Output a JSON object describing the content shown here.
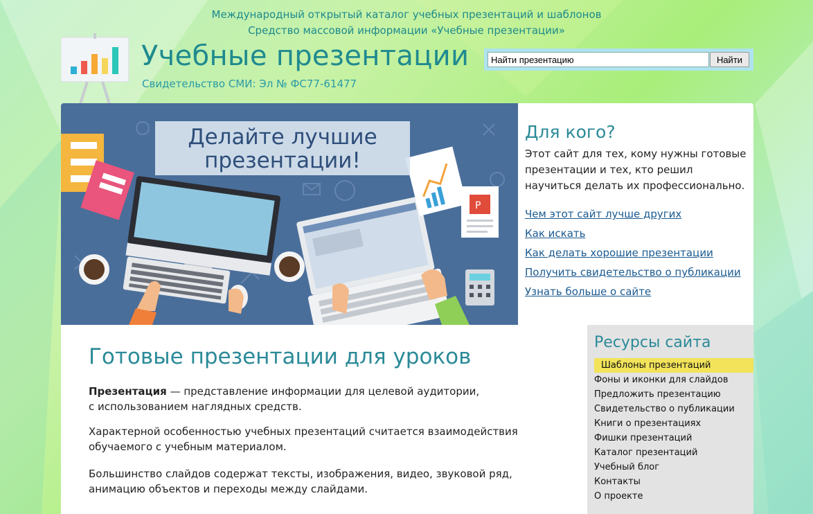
{
  "header": {
    "tagline1": "Международный открытый каталог учебных презентаций и шаблонов",
    "tagline2": "Средство массовой информации «Учебные презентации»",
    "site_title": "Учебные презентации",
    "certificate": "Свидетельство СМИ: Эл № ФС77-61477"
  },
  "search": {
    "value": "Найти презентацию",
    "button_label": "Найти"
  },
  "hero": {
    "banner_line1": "Делайте лучшие",
    "banner_line2": "презентации!"
  },
  "who": {
    "title": "Для кого?",
    "text": "Этот сайт для тех, кому нужны готовые презентации и тех, кто решил научиться делать их профессионально.",
    "links": [
      "Чем этот сайт лучше других",
      "Как искать",
      "Как делать хорошие презентации",
      "Получить свидетельство о публикации",
      "Узнать больше о сайте"
    ]
  },
  "main": {
    "title": "Готовые презентации для уроков",
    "p1_bold": "Презентация",
    "p1_line1": " — представление информации для целевой аудитории,",
    "p1_line2": "с использованием наглядных средств.",
    "p2_line1": "Характерной особенностью учебных презентаций считается взаимодействия",
    "p2_line2": "обучаемого с учебным материалом.",
    "p3_line1": "Большинство слайдов содержат тексты, изображения, видео, звуковой ряд,",
    "p3_line2": "анимацию объектов и переходы между слайдами."
  },
  "sidebar": {
    "title": "Ресурсы сайта",
    "items": [
      "Шаблоны презентаций",
      "Фоны и иконки для слайдов",
      "Предложить презентацию",
      "Свидетельство о публикации",
      "Книги о презентациях",
      "Фишки презентаций",
      "Каталог презентаций",
      "Учебный блог",
      "Контакты",
      "О проекте"
    ]
  },
  "colors": {
    "accent": "#2b8a98",
    "link": "#1a5a90",
    "highlight": "#f2e35a",
    "hero_bg": "#4a6e9a"
  }
}
